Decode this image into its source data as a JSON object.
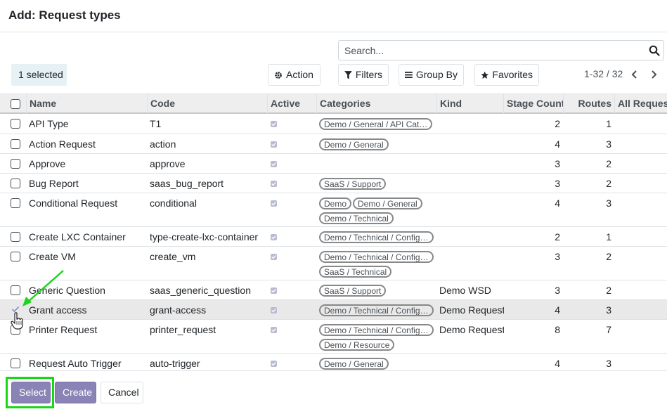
{
  "dialog": {
    "title": "Add: Request types"
  },
  "search": {
    "placeholder": "Search..."
  },
  "selection": {
    "label": "1 selected"
  },
  "toolbar": {
    "action": "Action",
    "filters": "Filters",
    "group_by": "Group By",
    "favorites": "Favorites"
  },
  "pager": {
    "text": "1-32 / 32"
  },
  "columns": {
    "name": "Name",
    "code": "Code",
    "active": "Active",
    "categories": "Categories",
    "kind": "Kind",
    "stage_count": "Stage Count",
    "routes": "Routes",
    "all_requests": "All Request"
  },
  "rows": [
    {
      "name": "API Type",
      "code": "T1",
      "categories": [
        "Demo / General / API Cat…"
      ],
      "kind": "",
      "stage_count": "2",
      "routes": "1"
    },
    {
      "name": "Action Request",
      "code": "action",
      "categories": [
        "Demo / General"
      ],
      "kind": "",
      "stage_count": "4",
      "routes": "3"
    },
    {
      "name": "Approve",
      "code": "approve",
      "categories": [],
      "kind": "",
      "stage_count": "3",
      "routes": "2"
    },
    {
      "name": "Bug Report",
      "code": "saas_bug_report",
      "categories": [
        "SaaS / Support"
      ],
      "kind": "",
      "stage_count": "3",
      "routes": "2"
    },
    {
      "name": "Conditional Request",
      "code": "conditional",
      "categories": [
        "Demo",
        "Demo / General",
        "Demo / Technical"
      ],
      "kind": "",
      "stage_count": "4",
      "routes": "3"
    },
    {
      "name": "Create LXC Container",
      "code": "type-create-lxc-container",
      "categories": [
        "Demo / Technical / Config…"
      ],
      "kind": "",
      "stage_count": "2",
      "routes": "1"
    },
    {
      "name": "Create VM",
      "code": "create_vm",
      "categories": [
        "Demo / Technical / Config…",
        "SaaS / Technical"
      ],
      "kind": "",
      "stage_count": "3",
      "routes": "2"
    },
    {
      "name": "Generic Question",
      "code": "saas_generic_question",
      "categories": [
        "SaaS / Support"
      ],
      "kind": "Demo WSD",
      "stage_count": "3",
      "routes": "2"
    },
    {
      "name": "Grant access",
      "code": "grant-access",
      "categories": [
        "Demo / Technical / Config…"
      ],
      "kind": "Demo Request",
      "stage_count": "4",
      "routes": "3",
      "selected": true
    },
    {
      "name": "Printer Request",
      "code": "printer_request",
      "categories": [
        "Demo / Technical / Config…",
        "Demo / Resource"
      ],
      "kind": "Demo Request",
      "stage_count": "8",
      "routes": "7"
    },
    {
      "name": "Request Auto Trigger",
      "code": "auto-trigger",
      "categories": [
        "Demo / General"
      ],
      "kind": "",
      "stage_count": "4",
      "routes": "3"
    }
  ],
  "footer": {
    "select": "Select",
    "create": "Create",
    "cancel": "Cancel"
  },
  "colors": {
    "primary": "#8a83b5",
    "highlight_box": "#19d61b",
    "arrow": "#19d61b",
    "selected_row": "#e9e9e9",
    "header_bg": "#eeeeee"
  }
}
